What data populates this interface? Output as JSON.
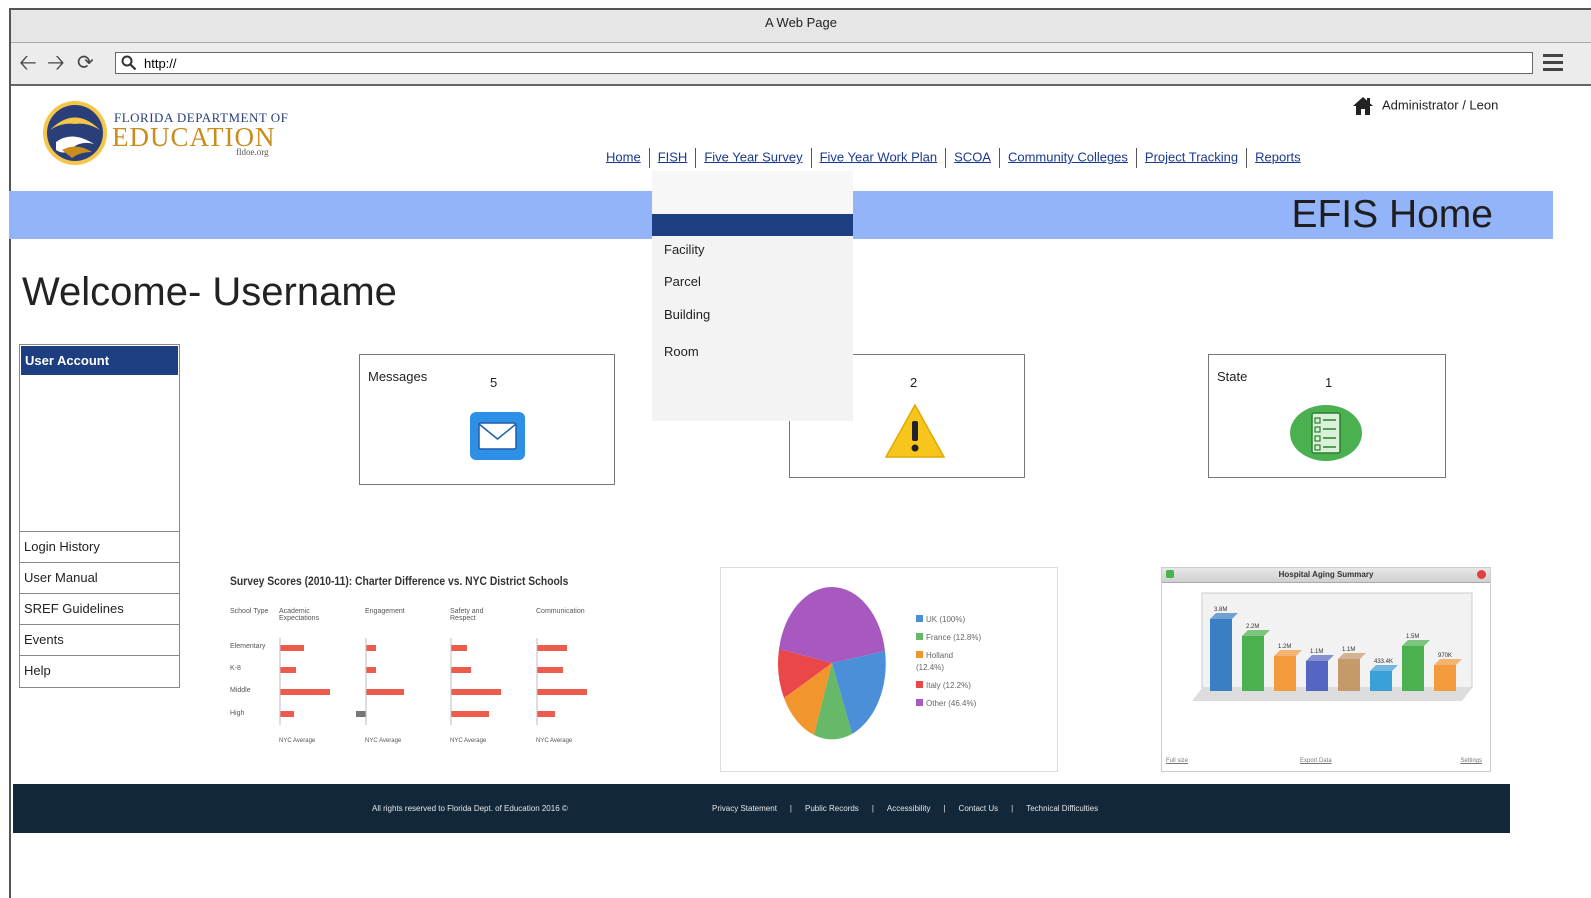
{
  "window": {
    "title": "A Web Page"
  },
  "browser": {
    "url": "http://"
  },
  "logo": {
    "line1": "FLORIDA DEPARTMENT OF",
    "line2": "EDUCATION",
    "line3": "fldoe.org"
  },
  "user": {
    "label": "Administrator / Leon"
  },
  "nav": {
    "items": [
      "Home",
      "FISH",
      "Five Year Survey",
      "Five Year Work Plan",
      "SCOA",
      "Community Colleges",
      "Project Tracking",
      "Reports"
    ]
  },
  "dropdown": {
    "items": [
      "Facility",
      "Parcel",
      "Building",
      "Room"
    ]
  },
  "banner": {
    "title": "EFIS Home"
  },
  "welcome": {
    "text": "Welcome- Username"
  },
  "sidebar": {
    "header": "User Account",
    "items": [
      "Login History",
      "User Manual",
      "SREF Guidelines",
      "Events",
      "Help"
    ]
  },
  "cards": [
    {
      "label": "Messages",
      "count": "5",
      "icon": "envelope-icon"
    },
    {
      "label": "",
      "count": "2",
      "icon": "warning-icon"
    },
    {
      "label": "State",
      "count": "1",
      "icon": "checklist-icon"
    }
  ],
  "survey_chart": {
    "title": "Survey Scores (2010-11): Charter Difference vs. NYC District Schools",
    "headers": [
      "School Type",
      "Academic Expectations",
      "Engagement",
      "Safety and Respect",
      "Communication"
    ],
    "rows": [
      "Elementary",
      "K-8",
      "Middle",
      "High"
    ],
    "footer": "NYC Average"
  },
  "pie_chart": {
    "legend": [
      "UK (100%)",
      "France (12.8%)",
      "Holland (12.4%)",
      "Italy (12.2%)",
      "Other (46.4%)"
    ],
    "colors": [
      "#4a8fd8",
      "#67b96a",
      "#f1962c",
      "#e9474a",
      "#a859c0"
    ]
  },
  "aging_chart": {
    "title": "Hospital Aging Summary",
    "bar_labels": [
      "3.8M",
      "2.2M",
      "1.2M",
      "1.1M",
      "1.1M",
      "433.4K",
      "1.5M",
      "970K"
    ],
    "colors": [
      "#3a7fc4",
      "#4bb04f",
      "#f39a3d",
      "#5566c2",
      "#c59a6a",
      "#3aa0d8",
      "#4bb04f",
      "#f39a3d"
    ],
    "footer_left": "Full size",
    "footer_mid": "Export Data",
    "footer_right": "Settings"
  },
  "footer": {
    "copyright": "All rights reserved to Florida Dept. of Education 2016 ©",
    "links": [
      "Privacy Statement",
      "Public Records",
      "Accessibility",
      "Contact Us",
      "Technical Difficulties"
    ]
  }
}
